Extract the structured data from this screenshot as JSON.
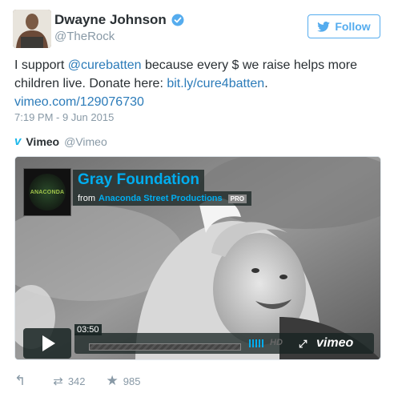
{
  "author": {
    "display_name": "Dwayne Johnson",
    "handle": "@TheRock",
    "verified": true
  },
  "follow_button": {
    "label": "Follow"
  },
  "tweet": {
    "text_1": "I support ",
    "mention": "@curebatten",
    "text_2": " because every $ we raise helps more children live. Donate here: ",
    "link_1": "bit.ly/cure4batten",
    "link_2": "vimeo.com/129076730",
    "timestamp": "7:19 PM - 9 Jun 2015"
  },
  "source": {
    "name": "Vimeo",
    "handle": "@Vimeo"
  },
  "video": {
    "logo_text": "ANACONDA",
    "title": "Gray Foundation",
    "by_prefix": "from",
    "by_name": "Anaconda Street Productions",
    "badge": "PRO",
    "time_tooltip": "03:50",
    "hd_label": "HD",
    "brand": "vimeo"
  },
  "stats": {
    "retweets": "342",
    "favorites": "985"
  },
  "colors": {
    "accent": "#55acee",
    "link": "#2b7bb9",
    "vimeo": "#00adef"
  }
}
